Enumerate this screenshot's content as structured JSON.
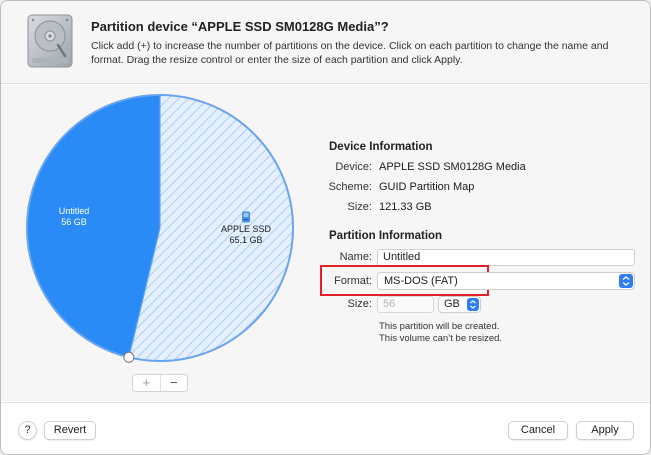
{
  "dialog": {
    "title": "Partition device “APPLE SSD SM0128G Media”?",
    "description": "Click add (+) to increase the number of partitions on the device. Click on each partition to change the name and format. Drag the resize control or enter the size of each partition and click Apply."
  },
  "pie": {
    "partitions": [
      {
        "name": "Untitled",
        "size": "56 GB",
        "size_gb": 56,
        "color": "#2a8af6",
        "style": "solid"
      },
      {
        "name": "APPLE SSD",
        "size": "65.1 GB",
        "size_gb": 65.1,
        "color": "#dfeefe",
        "style": "striped"
      }
    ],
    "add_symbol": "+",
    "remove_symbol": "−"
  },
  "device_info": {
    "title": "Device Information",
    "device_label": "Device:",
    "device_value": "APPLE SSD SM0128G Media",
    "scheme_label": "Scheme:",
    "scheme_value": "GUID Partition Map",
    "size_label": "Size:",
    "size_value": "121.33 GB"
  },
  "partition_info": {
    "title": "Partition Information",
    "name_label": "Name:",
    "name_value": "Untitled",
    "format_label": "Format:",
    "format_value": "MS-DOS (FAT)",
    "size_label": "Size:",
    "size_value": "56",
    "unit_value": "GB",
    "note_1": "This partition will be created.",
    "note_2": "This volume can’t be resized."
  },
  "footer": {
    "help": "?",
    "revert": "Revert",
    "cancel": "Cancel",
    "apply": "Apply"
  },
  "colors": {
    "accent": "#2f7cf6",
    "highlight": "#e2212a"
  }
}
